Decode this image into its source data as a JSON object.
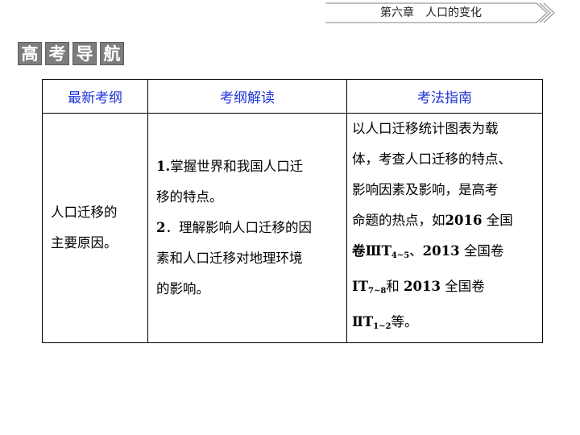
{
  "header": {
    "chapter": "第六章　人口的变化"
  },
  "section_tag": [
    "高",
    "考",
    "导",
    "航"
  ],
  "table": {
    "headers": [
      "最新考纲",
      "考纲解读",
      "考法指南"
    ],
    "col1": [
      "人口迁移的",
      "主要原因。"
    ],
    "col2": {
      "item1_num": "1.",
      "item1": [
        "掌握世界和我国人口迁",
        "移的特点。"
      ],
      "item2_num": "2",
      "item2": [
        "．理解影响人口迁移的因",
        "素和人口迁移对地理环境",
        "的影响。"
      ]
    },
    "col3": {
      "l1": "以人口迁移统计图表为载",
      "l2": "体，考查人口迁移的特点、",
      "l3": "影响因素及影响，是高考",
      "l4_a": "命题的热点，如",
      "l4_year": "2016",
      "l4_b": "全国",
      "l5_a": "卷ⅢT",
      "l5_sub": "4~5",
      "l5_b": "、",
      "l5_year": "2013",
      "l5_c": "全国卷",
      "l6_a": "ⅠT",
      "l6_sub": "7~8",
      "l6_b": "和",
      "l6_year": "2013",
      "l6_c": "全国卷",
      "l7_a": "ⅡT",
      "l7_sub": "1~2",
      "l7_b": "等。"
    }
  }
}
